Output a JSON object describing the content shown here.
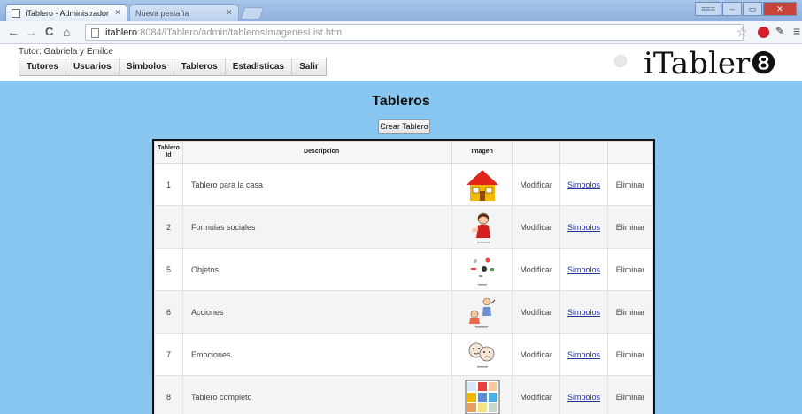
{
  "browser": {
    "tabs": [
      {
        "label": "iTablero - Administrador",
        "close": "×",
        "active": true
      },
      {
        "label": "Nueva pestaña",
        "close": "×",
        "active": false
      }
    ],
    "url_domain": "itablero",
    "url_rest": ":8084/iTablero/admin/tablerosImagenesList.html",
    "nav": {
      "back": "←",
      "forward": "→",
      "reload": "C",
      "home": "⌂"
    },
    "icons": {
      "star": "☆",
      "pencil": "✎",
      "menu": "≡"
    },
    "win": {
      "user": "≡≡≡",
      "min": "–",
      "max": "▭",
      "close": "✕"
    }
  },
  "header": {
    "tutor_label": "Tutor: Gabriela y Emilce",
    "menu": [
      "Tutores",
      "Usuarios",
      "Simbolos",
      "Tableros",
      "Estadisticas",
      "Salir"
    ],
    "logo": "iTabler",
    "logo_glyph": "❽"
  },
  "main": {
    "title": "Tableros",
    "create_button": "Crear Tablero",
    "columns": {
      "id_line1": "Tablero",
      "id_line2": "Id",
      "description": "Descripcion",
      "image": "Imagen"
    },
    "actions": {
      "modify": "Modificar",
      "symbols": "Simbolos",
      "delete": "Eliminar"
    },
    "rows": [
      {
        "id": "1",
        "description": "Tablero para la casa",
        "image": "house-icon"
      },
      {
        "id": "2",
        "description": "Formulas sociales",
        "image": "person-icon"
      },
      {
        "id": "5",
        "description": "Objetos",
        "image": "objects-icon"
      },
      {
        "id": "6",
        "description": "Acciones",
        "image": "actions-icon"
      },
      {
        "id": "7",
        "description": "Emociones",
        "image": "emotions-icon"
      },
      {
        "id": "8",
        "description": "Tablero completo",
        "image": "grid-icon"
      }
    ]
  },
  "colors": {
    "page_background": "#87c6f1",
    "link": "#2233aa",
    "house_roof": "#e2261c",
    "house_body": "#f2b800"
  }
}
